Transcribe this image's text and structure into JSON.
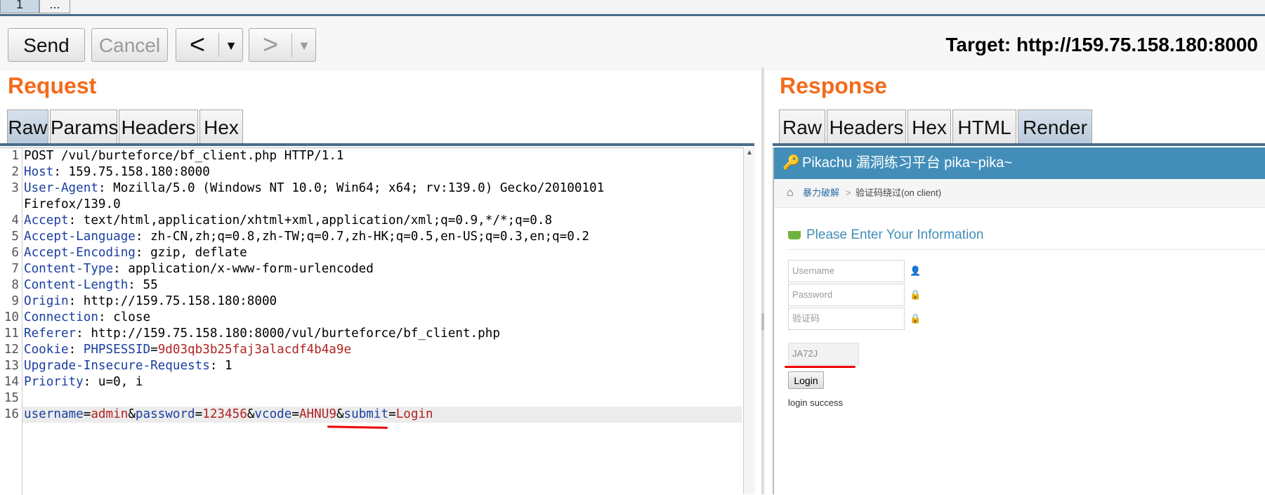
{
  "top_tabs": [
    "1",
    "..."
  ],
  "toolbar": {
    "send": "Send",
    "cancel": "Cancel",
    "back_arrow": "<",
    "forward_arrow": ">",
    "dropdown": "▼",
    "target": "Target: http://159.75.158.180:8000"
  },
  "request": {
    "title": "Request",
    "tabs": [
      "Raw",
      "Params",
      "Headers",
      "Hex"
    ],
    "active_tab": "Raw",
    "lines": [
      {
        "n": "1",
        "text": "POST /vul/burteforce/bf_client.php HTTP/1.1"
      },
      {
        "n": "2",
        "key": "Host",
        "val": ": 159.75.158.180:8000"
      },
      {
        "n": "3",
        "key": "User-Agent",
        "val": ": Mozilla/5.0 (Windows NT 10.0; Win64; x64; rv:139.0) Gecko/20100101"
      },
      {
        "n": "",
        "text": "Firefox/139.0"
      },
      {
        "n": "4",
        "key": "Accept",
        "val": ": text/html,application/xhtml+xml,application/xml;q=0.9,*/*;q=0.8"
      },
      {
        "n": "5",
        "key": "Accept-Language",
        "val": ": zh-CN,zh;q=0.8,zh-TW;q=0.7,zh-HK;q=0.5,en-US;q=0.3,en;q=0.2"
      },
      {
        "n": "6",
        "key": "Accept-Encoding",
        "val": ": gzip, deflate"
      },
      {
        "n": "7",
        "key": "Content-Type",
        "val": ": application/x-www-form-urlencoded"
      },
      {
        "n": "8",
        "key": "Content-Length",
        "val": ": 55"
      },
      {
        "n": "9",
        "key": "Origin",
        "val": ": http://159.75.158.180:8000"
      },
      {
        "n": "10",
        "key": "Connection",
        "val": ": close"
      },
      {
        "n": "11",
        "key": "Referer",
        "val": ": http://159.75.158.180:8000/vul/burteforce/bf_client.php"
      },
      {
        "n": "12",
        "key": "Cookie",
        "val": ": "
      },
      {
        "n": "13",
        "key": "Upgrade-Insecure-Requests",
        "val": ": 1"
      },
      {
        "n": "14",
        "key": "Priority",
        "val": ": u=0, i"
      },
      {
        "n": "15",
        "text": ""
      },
      {
        "n": "16",
        "text": ""
      }
    ],
    "cookie_name": "PHPSESSID",
    "cookie_value": "9d03qb3b25faj3alacdf4b4a9e",
    "body": {
      "k1": "username",
      "v1": "admin",
      "k2": "password",
      "v2": "123456",
      "k3": "vcode",
      "v3": "AHNU9",
      "k4": "submit",
      "v4": "Login"
    }
  },
  "response": {
    "title": "Response",
    "tabs": [
      "Raw",
      "Headers",
      "Hex",
      "HTML",
      "Render"
    ],
    "active_tab": "Render",
    "page": {
      "header": "Pikachu 漏洞练习平台 pika~pika~",
      "breadcrumb_link": "暴力破解",
      "breadcrumb_sep": ">",
      "breadcrumb_current": "验证码绕过(on client)",
      "info_title": "Please Enter Your Information",
      "username_placeholder": "Username",
      "password_placeholder": "Password",
      "vcode_placeholder": "验证码",
      "captcha": "JA72J",
      "login_button": "Login",
      "message": "login success"
    }
  },
  "colors": {
    "accent_orange": "#f36b1c",
    "header_blue": "#438eb9",
    "key_blue": "#1a3fa0",
    "value_red": "#b22222"
  }
}
